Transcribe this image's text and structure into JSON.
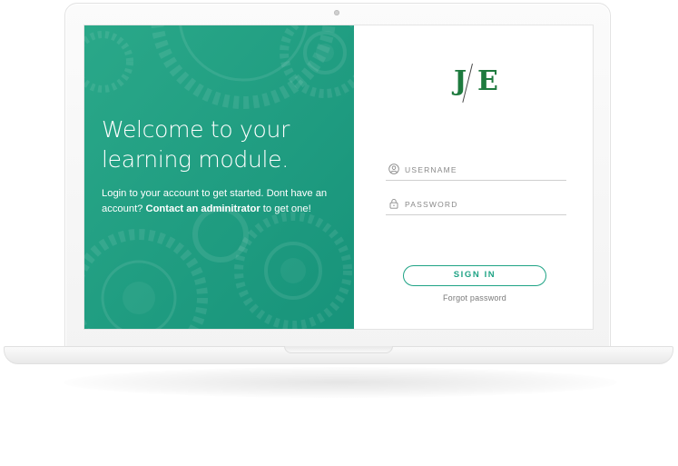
{
  "hero": {
    "title_line1": "Welcome to your",
    "title_line2": "learning module.",
    "text_intro": "Login to your account to get started. Dont have an account? ",
    "text_link": "Contact an adminitrator",
    "text_outro": " to get one!"
  },
  "logo": {
    "letter_left": "J",
    "letter_right": "E"
  },
  "form": {
    "username_placeholder": "USERNAME",
    "username_icon": "user-icon",
    "password_placeholder": "PASSWORD",
    "password_icon": "lock-icon",
    "signin_label": "SIGN IN",
    "forgot_label": "Forgot password"
  },
  "colors": {
    "accent": "#1fa385",
    "hero_green": "#1e9e80",
    "logo_green": "#1e7a3e"
  }
}
